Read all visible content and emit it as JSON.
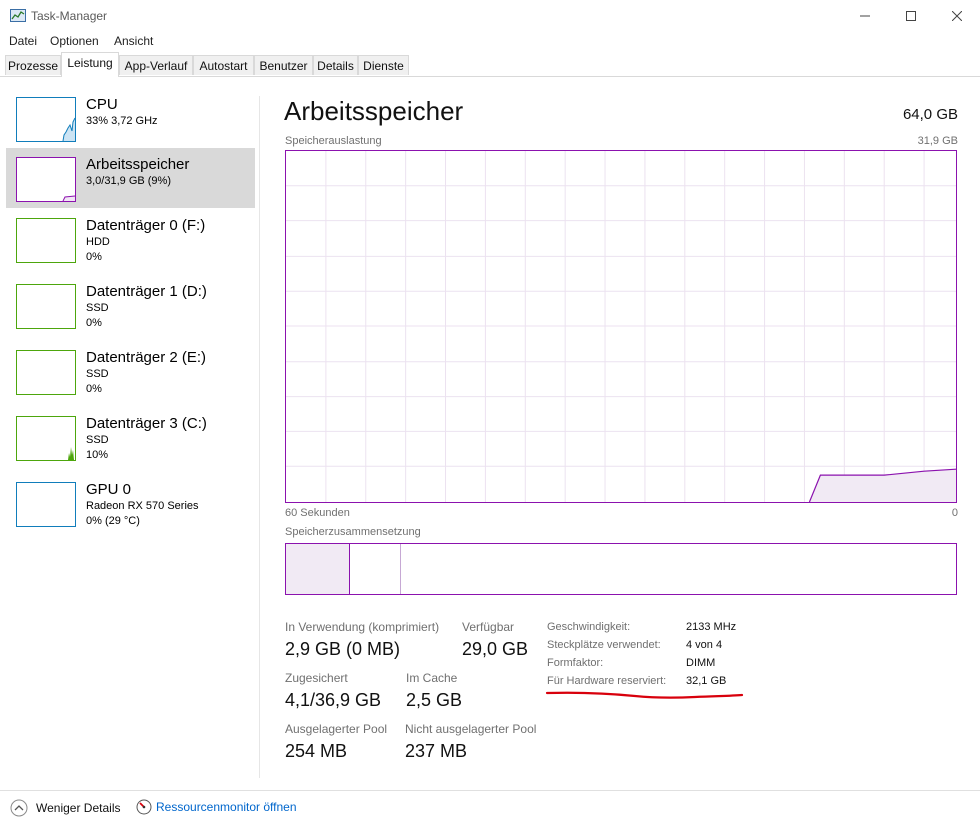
{
  "window": {
    "title": "Task-Manager"
  },
  "menu": [
    "Datei",
    "Optionen",
    "Ansicht"
  ],
  "tabs": [
    "Prozesse",
    "Leistung",
    "App-Verlauf",
    "Autostart",
    "Benutzer",
    "Details",
    "Dienste"
  ],
  "sidebar": [
    {
      "title": "CPU",
      "sub1": "33% 3,72 GHz",
      "sub2": ""
    },
    {
      "title": "Arbeitsspeicher",
      "sub1": "3,0/31,9 GB (9%)",
      "sub2": ""
    },
    {
      "title": "Datenträger 0 (F:)",
      "sub1": "HDD",
      "sub2": "0%"
    },
    {
      "title": "Datenträger 1 (D:)",
      "sub1": "SSD",
      "sub2": "0%"
    },
    {
      "title": "Datenträger 2 (E:)",
      "sub1": "SSD",
      "sub2": "0%"
    },
    {
      "title": "Datenträger 3 (C:)",
      "sub1": "SSD",
      "sub2": "10%"
    },
    {
      "title": "GPU 0",
      "sub1": "Radeon RX 570 Series",
      "sub2": "0% (29 °C)"
    }
  ],
  "main": {
    "title": "Arbeitsspeicher",
    "total": "64,0 GB",
    "usage_label": "Speicherauslastung",
    "usage_max": "31,9 GB",
    "time_left": "60 Sekunden",
    "time_right": "0",
    "composition_label": "Speicherzusammensetzung"
  },
  "stats": {
    "in_use_label": "In Verwendung (komprimiert)",
    "in_use_value": "2,9 GB (0 MB)",
    "available_label": "Verfügbar",
    "available_value": "29,0 GB",
    "committed_label": "Zugesichert",
    "committed_value": "4,1/36,9 GB",
    "cached_label": "Im Cache",
    "cached_value": "2,5 GB",
    "paged_label": "Ausgelagerter Pool",
    "paged_value": "254 MB",
    "nonpaged_label": "Nicht ausgelagerter Pool",
    "nonpaged_value": "237 MB"
  },
  "details": [
    {
      "label": "Geschwindigkeit:",
      "value": "2133 MHz"
    },
    {
      "label": "Steckplätze verwendet:",
      "value": "4 von 4"
    },
    {
      "label": "Formfaktor:",
      "value": "DIMM"
    },
    {
      "label": "Für Hardware reserviert:",
      "value": "32,1 GB"
    }
  ],
  "footer": {
    "fewer_details": "Weniger Details",
    "resource_monitor": "Ressourcenmonitor öffnen"
  },
  "colors": {
    "memory": "#8b12ae",
    "cpu": "#117dbb",
    "disk": "#4da60c",
    "link": "#0066cc",
    "annotation": "#d8000c"
  }
}
